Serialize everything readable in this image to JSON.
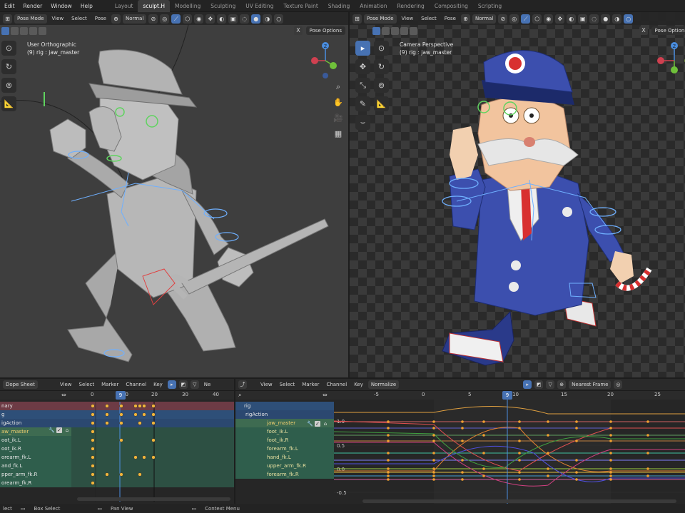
{
  "topbar": {
    "menus": [
      "Edit",
      "Render",
      "Window",
      "Help"
    ],
    "workspaces": [
      "Layout",
      "sculpt.H",
      "Modelling",
      "Sculpting",
      "UV Editing",
      "Texture Paint",
      "Shading",
      "Animation",
      "Rendering",
      "Compositing",
      "Scripting"
    ],
    "active_workspace": "sculpt.H"
  },
  "viewport_left": {
    "mode": "Pose Mode",
    "menus": [
      "View",
      "Select",
      "Pose"
    ],
    "orientation": "Normal",
    "pose_options": "Pose Options",
    "view_name": "User Orthographic",
    "object_info": "(9) rig : jaw_master"
  },
  "viewport_right": {
    "mode": "Pose Mode",
    "menus": [
      "View",
      "Select",
      "Pose"
    ],
    "orientation": "Normal",
    "pose_options": "Pose Options",
    "view_name": "Camera Perspective",
    "object_info": "(9) rig : jaw_master"
  },
  "dopesheet": {
    "editor": "Dope Sheet",
    "menus": [
      "View",
      "Select",
      "Marker",
      "Channel",
      "Key"
    ],
    "truncated_label": "Ne",
    "current_frame": "9",
    "ruler": [
      "0",
      "10",
      "20",
      "30",
      "40"
    ],
    "channels": [
      "nary",
      "g",
      "igAction",
      "aw_master",
      "oot_ik.L",
      "oot_ik.R",
      "orearm_fk.L",
      "and_fk.L",
      "pper_arm_fk.R",
      "orearm_fk.R"
    ]
  },
  "graph": {
    "menus": [
      "View",
      "Select",
      "Marker",
      "Channel",
      "Key"
    ],
    "normalize": "Normalize",
    "interpolation": "Nearest Frame",
    "current_frame": "9",
    "ruler": [
      "-5",
      "0",
      "5",
      "10",
      "15",
      "20",
      "25"
    ],
    "y_labels": [
      "1.0",
      "0.5",
      "0.0",
      "-0.5"
    ],
    "channels": [
      "rig",
      "rigAction",
      "jaw_master",
      "foot_ik.L",
      "foot_ik.R",
      "forearm_fk.L",
      "hand_fk.L",
      "upper_arm_fk.R",
      "forearm_fk.R"
    ]
  },
  "statusbar": {
    "items": [
      "lect",
      "Box Select",
      "Pan View",
      "Context Menu"
    ]
  },
  "colors": {
    "accent": "#4772b3",
    "playhead": "#4a8ee0",
    "keyframe": "#f0b43c",
    "uniform_blue": "#3c4fae"
  }
}
